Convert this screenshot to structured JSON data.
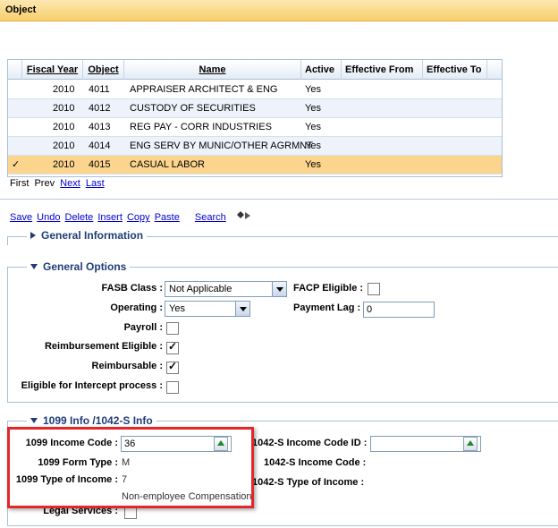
{
  "window": {
    "title": "Object"
  },
  "grid": {
    "columns": [
      "Fiscal Year",
      "Object",
      "Name",
      "Active",
      "Effective From",
      "Effective To"
    ],
    "rows": [
      {
        "check": "",
        "year": "2010",
        "object": "4011",
        "name": "APPRAISER ARCHITECT & ENG",
        "active": "Yes"
      },
      {
        "check": "",
        "year": "2010",
        "object": "4012",
        "name": "CUSTODY OF SECURITIES",
        "active": "Yes"
      },
      {
        "check": "",
        "year": "2010",
        "object": "4013",
        "name": "REG PAY - CORR INDUSTRIES",
        "active": "Yes"
      },
      {
        "check": "",
        "year": "2010",
        "object": "4014",
        "name": "ENG SERV BY MUNIC/OTHER AGRMNT",
        "active": "Yes"
      },
      {
        "check": "✓",
        "year": "2010",
        "object": "4015",
        "name": "CASUAL LABOR",
        "active": "Yes"
      }
    ]
  },
  "pager": {
    "first": "First",
    "prev": "Prev",
    "next": "Next",
    "last": "Last"
  },
  "toolbar": {
    "save": "Save",
    "undo": "Undo",
    "delete": "Delete",
    "insert": "Insert",
    "copy": "Copy",
    "paste": "Paste",
    "search": "Search"
  },
  "general_info": {
    "title": "General Information"
  },
  "general_options": {
    "title": "General Options",
    "fasb_label": "FASB Class :",
    "fasb_value": "Not Applicable",
    "facp_label": "FACP Eligible :",
    "operating_label": "Operating :",
    "operating_value": "Yes",
    "payment_lag_label": "Payment Lag :",
    "payment_lag_value": "0",
    "payroll_label": "Payroll :",
    "reimb_eligible_label": "Reimbursement Eligible :",
    "reimbursable_label": "Reimbursable :",
    "intercept_label": "Eligible for Intercept process :",
    "check_mark": "✓"
  },
  "info_1099": {
    "title": "1099 Info /1042-S Info",
    "income_code_label": "1099 Income Code :",
    "income_code_value": "36",
    "form_type_label": "1099 Form Type :",
    "form_type_value": "M",
    "type_income_label": "1099 Type of Income :",
    "type_income_value": "7",
    "type_income_desc": "Non-employee Compensation",
    "s_income_code_id_label": "1042-S Income Code ID :",
    "s_income_code_label": "1042-S Income Code :",
    "s_type_income_label": "1042-S Type of Income :",
    "legal_services_label": "Legal Services :"
  }
}
